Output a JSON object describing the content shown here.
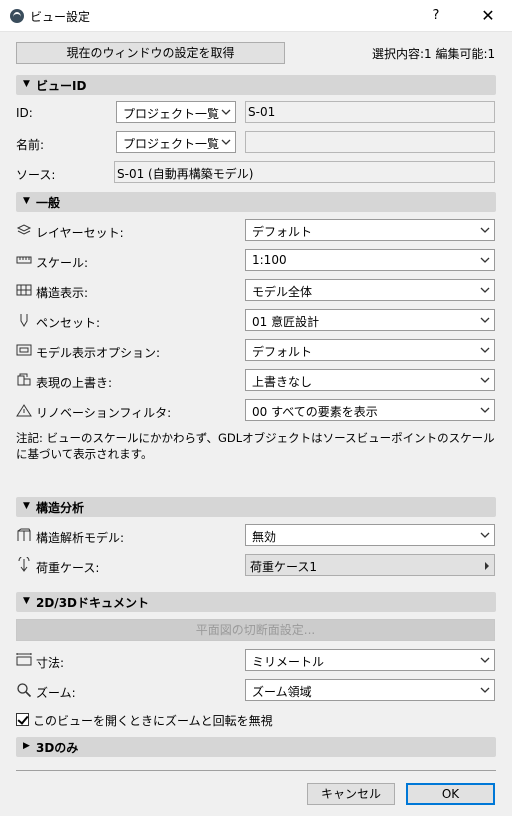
{
  "window": {
    "title": "ビュー設定",
    "help": "?",
    "close": "✕"
  },
  "toolbar": {
    "get_settings_label": "現在のウィンドウの設定を取得",
    "selection_info": "選択内容:1 編集可能:1"
  },
  "sections": {
    "view_id": {
      "label": "ビューID",
      "arrow": "▼"
    },
    "general": {
      "label": "一般",
      "arrow": "▼"
    },
    "structural": {
      "label": "構造分析",
      "arrow": "▼"
    },
    "doc2d3d": {
      "label": "2D/3Dドキュメント",
      "arrow": "▼"
    },
    "only3d": {
      "label": "3Dのみ",
      "arrow": "▶"
    }
  },
  "view_id": {
    "id_label": "ID:",
    "id_select": "プロジェクト一覧",
    "id_value": "S-01",
    "name_label": "名前:",
    "name_select": "プロジェクト一覧",
    "name_value": "",
    "source_label": "ソース:",
    "source_value": "S-01 (自動再構築モデル)"
  },
  "general": {
    "rows": [
      {
        "label": "レイヤーセット:",
        "value": "デフォルト",
        "icon": "layers-icon"
      },
      {
        "label": "スケール:",
        "value": "1:100",
        "icon": "ruler-icon"
      },
      {
        "label": "構造表示:",
        "value": "モデル全体",
        "icon": "structure-icon"
      },
      {
        "label": "ペンセット:",
        "value": "01 意匠設計",
        "icon": "pen-icon"
      },
      {
        "label": "モデル表示オプション:",
        "value": "デフォルト",
        "icon": "display-options-icon"
      },
      {
        "label": "表現の上書き:",
        "value": "上書きなし",
        "icon": "override-icon"
      },
      {
        "label": "リノベーションフィルタ:",
        "value": "00 すべての要素を表示",
        "icon": "renovation-icon"
      }
    ],
    "note": "注記: ビューのスケールにかかわらず、GDLオブジェクトはソースビューポイントのスケールに基づいて表示されます。"
  },
  "structural": {
    "model_label": "構造解析モデル:",
    "model_value": "無効",
    "load_label": "荷重ケース:",
    "load_value": "荷重ケース1"
  },
  "doc": {
    "cutplane_button": "平面図の切断面設定...",
    "dim_label": "寸法:",
    "dim_value": "ミリメートル",
    "zoom_label": "ズーム:",
    "zoom_value": "ズーム領域",
    "ignore_zoom_label": "このビューを開くときにズームと回転を無視"
  },
  "footer": {
    "cancel": "キャンセル",
    "ok": "OK"
  }
}
